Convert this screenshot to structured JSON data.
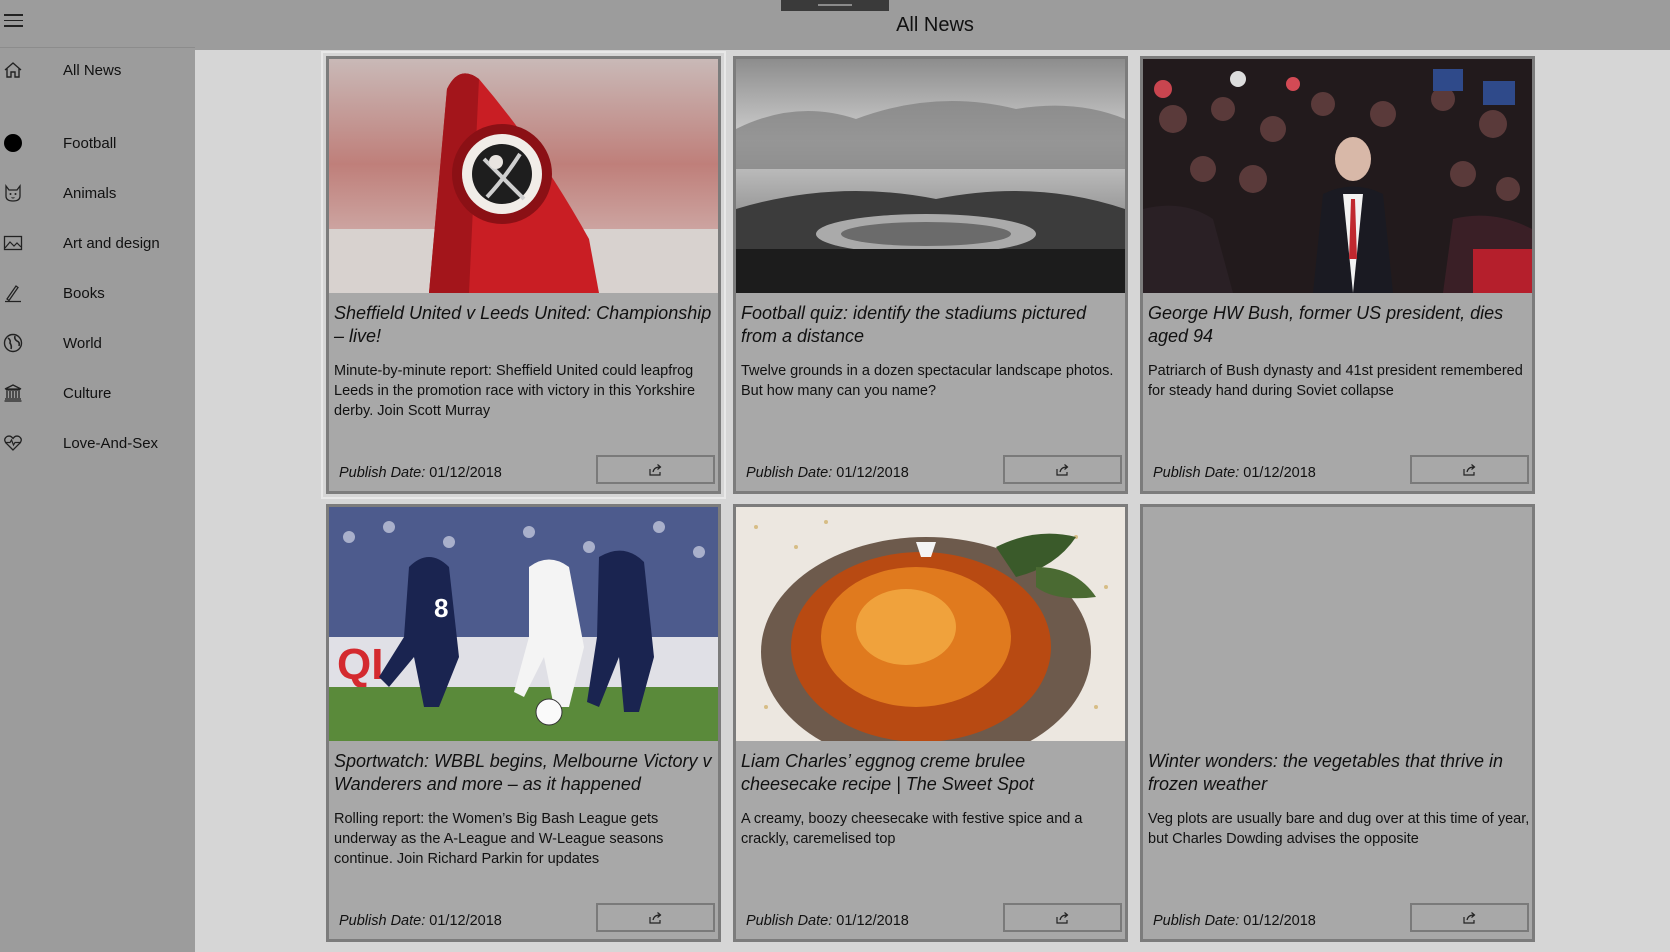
{
  "header": {
    "title": "All News"
  },
  "sidebar": {
    "menu_icon": "hamburger-icon",
    "items": [
      {
        "label": "All News",
        "icon": "home-icon"
      },
      {
        "label": "Football",
        "icon": "ball-icon"
      },
      {
        "label": "Animals",
        "icon": "cat-icon"
      },
      {
        "label": "Art and design",
        "icon": "picture-icon"
      },
      {
        "label": "Books",
        "icon": "pen-icon"
      },
      {
        "label": "World",
        "icon": "globe-icon"
      },
      {
        "label": "Culture",
        "icon": "museum-icon"
      },
      {
        "label": "Love-And-Sex",
        "icon": "heartbeat-icon"
      }
    ]
  },
  "articles": [
    {
      "headline": "Sheffield United v Leeds United: Championship – live!",
      "summary": "Minute-by-minute report: Sheffield United could leapfrog Leeds in the promotion race with victory in this Yorkshire derby. Join Scott Murray",
      "date_label": "Publish Date:",
      "date": "01/12/2018",
      "image": "corner-flag-photo"
    },
    {
      "headline": "Football quiz: identify the stadiums pictured from a distance",
      "summary": "Twelve grounds in a dozen spectacular landscape photos. But how many can you name?",
      "date_label": "Publish Date:",
      "date": "01/12/2018",
      "image": "stadium-landscape-photo"
    },
    {
      "headline": "George HW Bush, former US president, dies aged 94",
      "summary": "Patriarch of Bush dynasty and 41st president remembered for steady hand during Soviet collapse",
      "date_label": "Publish Date:",
      "date": "01/12/2018",
      "image": "crowd-rally-photo"
    },
    {
      "headline": "Sportwatch: WBBL begins, Melbourne Victory v Wanderers and more – as it happened",
      "summary": "Rolling report: the Women’s Big Bash League gets underway as the A-League and W-League seasons continue. Join Richard Parkin for updates",
      "date_label": "Publish Date:",
      "date": "01/12/2018",
      "image": "football-match-photo"
    },
    {
      "headline": "Liam Charles’ eggnog creme brulee cheesecake recipe | The Sweet Spot",
      "summary": "A creamy, boozy cheesecake with festive spice and a crackly, caremelised top",
      "date_label": "Publish Date:",
      "date": "01/12/2018",
      "image": "cheesecake-photo"
    },
    {
      "headline": "Winter wonders: the vegetables that thrive in frozen weather",
      "summary": "Veg plots are usually bare and dug over at this time of year, but Charles Dowding advises the opposite",
      "date_label": "Publish Date:",
      "date": "01/12/2018",
      "image": ""
    }
  ],
  "colors": {
    "chrome": "#9c9c9c",
    "card_bg": "#a8a8a8",
    "card_border": "#7c7c7c",
    "page_bg": "#d6d6d6"
  }
}
